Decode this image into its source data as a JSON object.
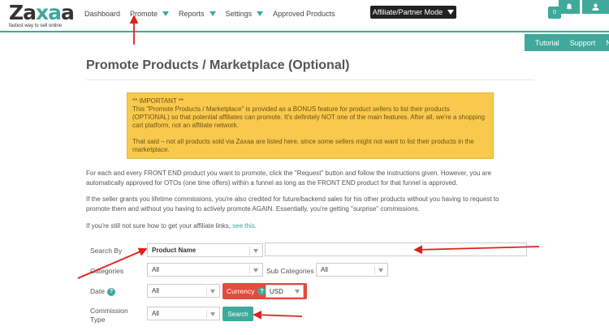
{
  "logo": {
    "brand": "Zaxaa",
    "tagline": "fastest way to sell online"
  },
  "nav": {
    "items": [
      {
        "label": "Dashboard",
        "caret": false
      },
      {
        "label": "Promote",
        "caret": true
      },
      {
        "label": "Reports",
        "caret": true
      },
      {
        "label": "Settings",
        "caret": true
      },
      {
        "label": "Approved Products",
        "caret": false
      }
    ]
  },
  "mode_button": {
    "label": "Affiliate/Partner Mode"
  },
  "notifications": {
    "count": "0"
  },
  "subbar": {
    "items": [
      "Tutorial",
      "Support",
      "Ne"
    ]
  },
  "page": {
    "title": "Promote Products / Marketplace (Optional)"
  },
  "notice": {
    "heading": "** IMPORTANT **",
    "body": "This \"Promote Products / Marketplace\" is provided as a BONUS feature for product sellers to list their products (OPTIONAL) so that potential affiliates can promote. It's definitely NOT one of the main features. After all, we're a shopping cart platform, not an affiliate network.",
    "note": "That said – not all products sold via Zaxaa are listed here, since some sellers might not want to list their products in the marketplace."
  },
  "info": {
    "p1": "For each and every FRONT END product you want to promote, click the \"Request\" button and follow the instructions given. However, you are automatically approved for OTOs (one time offers) within a funnel as long as the FRONT END product for that funnel is approved.",
    "p2": "If the seller grants you lifetime commissions, you're also credited for future/backend sales for his other products without you having to request to promote them and without you having to actively promote AGAIN. Essentially, you're getting \"surprise\" commissions.",
    "p3_prefix": "If you're still not sure how to get your affiliate links, ",
    "p3_link": "see this",
    "p3_suffix": "."
  },
  "filters": {
    "search_by_label": "Search By",
    "search_by_value": "Product Name",
    "search_input_value": "",
    "categories_label": "Categories",
    "categories_value": "All",
    "subcategories_label": "Sub Categories",
    "subcategories_value": "All",
    "date_label": "Date",
    "date_value": "All",
    "currency_label": "Currency",
    "currency_value": "USD",
    "commission_label": "Commission Type",
    "commission_value": "All",
    "search_button": "Search"
  },
  "colors": {
    "accent": "#3fa99b",
    "notice": "#f9c94e",
    "currency": "#e24b3d",
    "annotation_arrow": "#e0201a"
  }
}
